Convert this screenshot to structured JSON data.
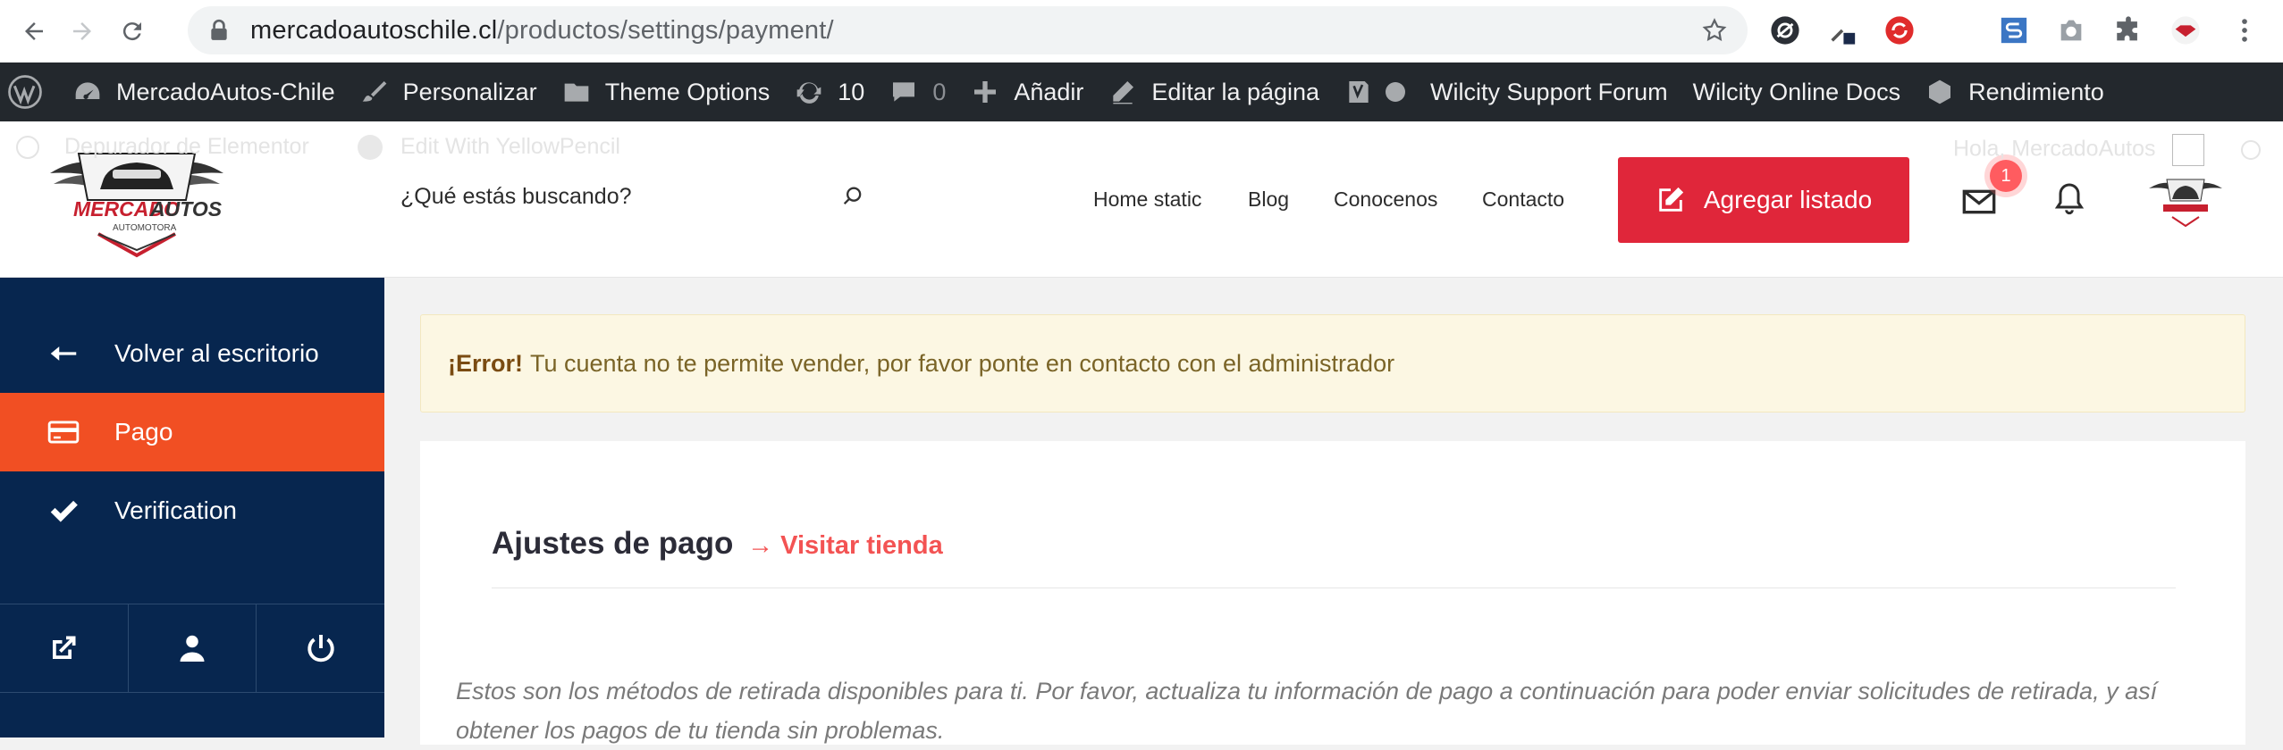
{
  "browser": {
    "url_domain": "mercadoautoschile.cl",
    "url_path": "/productos/settings/payment/"
  },
  "wp_admin_bar": {
    "site_name": "MercadoAutos-Chile",
    "customize": "Personalizar",
    "theme_options": "Theme Options",
    "updates_count": "10",
    "comments_count": "0",
    "add_new": "Añadir",
    "edit_page": "Editar la página",
    "support_forum": "Wilcity Support Forum",
    "online_docs": "Wilcity Online Docs",
    "performance": "Rendimiento"
  },
  "ghost_bar": {
    "elementor": "Depurador de Elementor",
    "yellowpencil": "Edit With YellowPencil",
    "greeting": "Hola, MercadoAutos"
  },
  "header": {
    "search_placeholder": "¿Qué estás buscando?",
    "menu": [
      "Home static",
      "Blog",
      "Conocenos",
      "Contacto"
    ],
    "add_listing": "Agregar listado",
    "notification_count": "1"
  },
  "logo": {
    "brand_part1": "MERCADO",
    "brand_part2": "AUTOS",
    "tagline": "AUTOMOTORA"
  },
  "sidebar": {
    "items": [
      {
        "label": "Volver al escritorio",
        "icon": "arrow-left-icon"
      },
      {
        "label": "Pago",
        "icon": "credit-card-icon"
      },
      {
        "label": "Verification",
        "icon": "check-icon"
      }
    ]
  },
  "alert": {
    "strong": "¡Error!",
    "message": "Tu cuenta no te permite vender, por favor ponte en contacto con el administrador"
  },
  "content": {
    "title": "Ajustes de pago",
    "visit_store": "→ Visitar tienda",
    "description": "Estos son los métodos de retirada disponibles para ti. Por favor, actualiza tu información de pago a continuación para poder enviar solicitudes de retirada, y así obtener los pagos de tu tienda sin problemas."
  },
  "colors": {
    "accent_orange": "#f14f23",
    "sidebar_navy": "#07264f",
    "add_button_red": "#e0263a",
    "link_red": "#f35353"
  }
}
